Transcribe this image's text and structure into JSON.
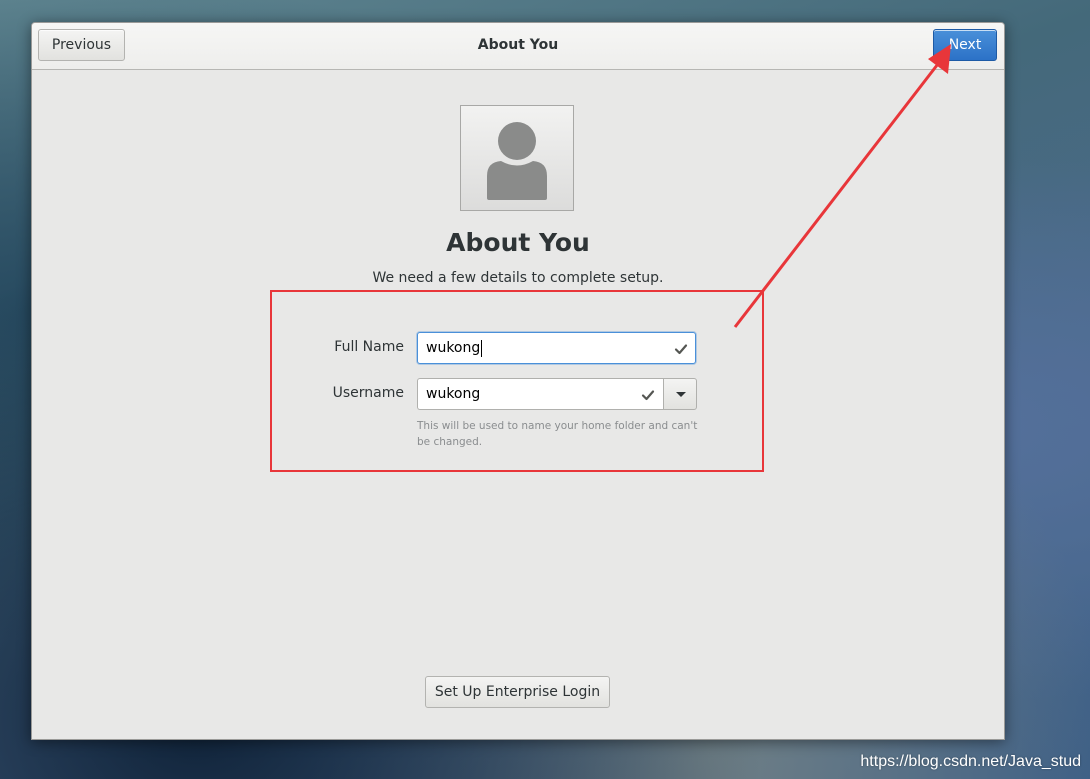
{
  "header": {
    "previous_label": "Previous",
    "title": "About You",
    "next_label": "Next"
  },
  "main": {
    "avatar_icon": "user-avatar-icon",
    "title": "About You",
    "subtitle": "We need a few details to complete setup.",
    "form": {
      "full_name_label": "Full Name",
      "full_name_value": "wukong",
      "username_label": "Username",
      "username_value": "wukong",
      "username_hint": "This will be used to name your home folder and can't be changed."
    },
    "enterprise_login_label": "Set Up Enterprise Login"
  },
  "annotation": {
    "color": "#e8363a"
  },
  "watermark": "https://blog.csdn.net/Java_stud",
  "colors": {
    "accent": "#4a90d9",
    "window_bg": "#e8e8e7"
  }
}
